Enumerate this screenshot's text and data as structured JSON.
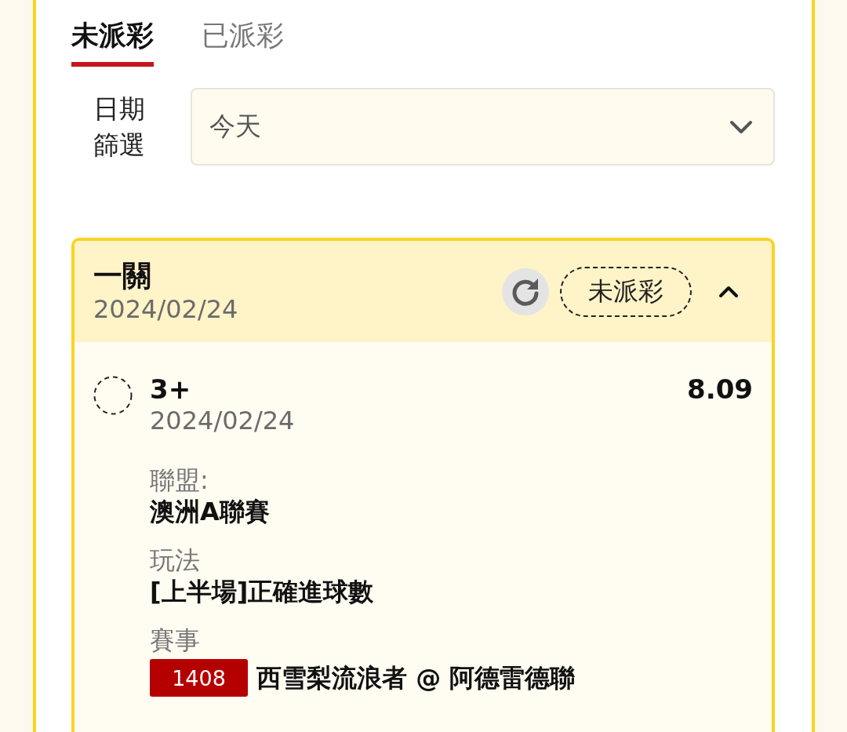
{
  "tabs": [
    {
      "label": "未派彩",
      "selected": true
    },
    {
      "label": "已派彩",
      "selected": false
    }
  ],
  "date_filter": {
    "label": "日期篩選",
    "value": "今天"
  },
  "bet": {
    "title": "一關",
    "date": "2024/02/24",
    "status": "未派彩",
    "expanded": true,
    "legs": [
      {
        "selection": "3+",
        "date": "2024/02/24",
        "odds": "8.09",
        "details": [
          {
            "kind": "text",
            "label": "聯盟:",
            "value": "澳洲A聯賽"
          },
          {
            "kind": "text",
            "label": "玩法",
            "value": "[上半場]正確進球數"
          },
          {
            "kind": "match",
            "label": "賽事",
            "match_no": "1408",
            "value": "西雪梨流浪者 @ 阿德雷德聯"
          }
        ]
      }
    ]
  }
}
